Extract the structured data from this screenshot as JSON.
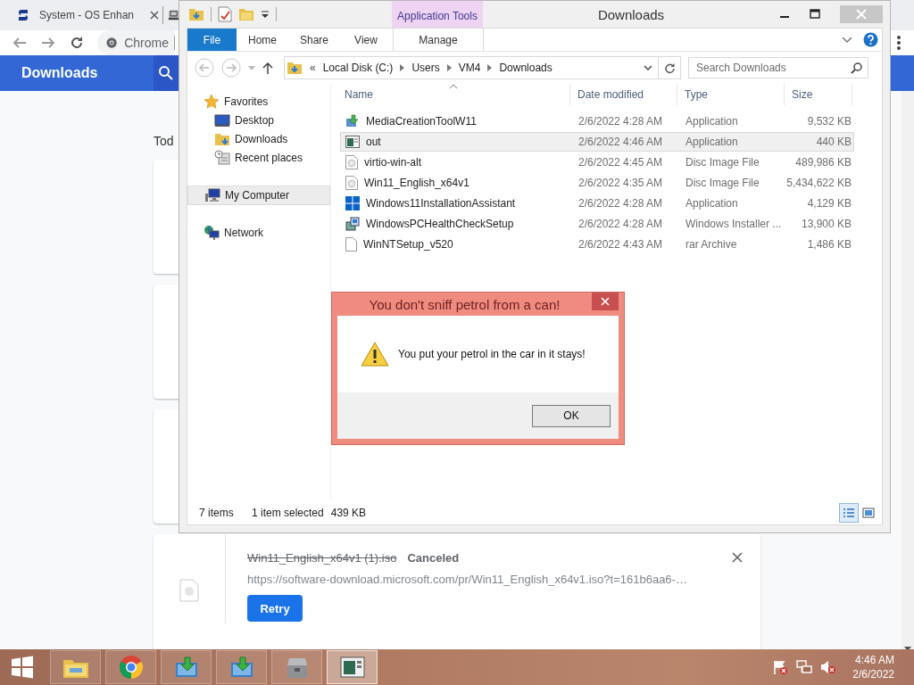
{
  "browser": {
    "tab": {
      "title": "System - OS Enhan"
    },
    "omnibox": {
      "text": "Chrome"
    },
    "header": {
      "title": "Downloads"
    },
    "section_heading": "Tod",
    "cards": [
      {
        "kind": "covered"
      },
      {
        "kind": "covered"
      },
      {
        "kind": "covered"
      },
      {
        "kind": "download",
        "file_name": "Win11_English_x64v1 (1).iso",
        "canceled": true,
        "status": "Canceled",
        "url": "https://software-download.microsoft.com/pr/Win11_English_x64v1.iso?t=161b6aa6-…",
        "action": "Retry"
      }
    ]
  },
  "explorer": {
    "title": "Downloads",
    "contextual_group": "Application Tools",
    "file_tab": "File",
    "tabs": [
      {
        "label": "Home",
        "contextual": false
      },
      {
        "label": "Share",
        "contextual": false
      },
      {
        "label": "View",
        "contextual": false
      },
      {
        "label": "Manage",
        "contextual": true
      }
    ],
    "breadcrumb": [
      "Local Disk (C:)",
      "Users",
      "VM4",
      "Downloads"
    ],
    "breadcrumb_overflow": "«",
    "search": {
      "placeholder": "Search Downloads"
    },
    "nav": [
      {
        "label": "Favorites",
        "kind": "favorites",
        "selected": false,
        "children": [
          {
            "label": "Desktop",
            "kind": "desktop",
            "selected": false
          },
          {
            "label": "Downloads",
            "kind": "downloads",
            "selected": false
          },
          {
            "label": "Recent places",
            "kind": "recent",
            "selected": false
          }
        ]
      },
      {
        "label": "My Computer",
        "kind": "computer",
        "selected": true
      },
      {
        "label": "Network",
        "kind": "network",
        "selected": false
      }
    ],
    "columns": [
      "Name",
      "Date modified",
      "Type",
      "Size"
    ],
    "files": [
      {
        "name": "MediaCreationToolW11",
        "date": "2/6/2022 4:28 AM",
        "type": "Application",
        "size": "9,532 KB",
        "kind": "setup",
        "selected": false
      },
      {
        "name": "out",
        "date": "2/6/2022 4:46 AM",
        "type": "Application",
        "size": "440 KB",
        "kind": "app",
        "selected": true
      },
      {
        "name": "virtio-win-alt",
        "date": "2/6/2022 4:45 AM",
        "type": "Disc Image File",
        "size": "489,986 KB",
        "kind": "disc",
        "selected": false
      },
      {
        "name": "Win11_English_x64v1",
        "date": "2/6/2022 4:35 AM",
        "type": "Disc Image File",
        "size": "5,434,622 KB",
        "kind": "disc",
        "selected": false
      },
      {
        "name": "Windows11InstallationAssistant",
        "date": "2/6/2022 4:28 AM",
        "type": "Application",
        "size": "4,129 KB",
        "kind": "windows",
        "selected": false
      },
      {
        "name": "WindowsPCHealthCheckSetup",
        "date": "2/6/2022 4:28 AM",
        "type": "Windows Installer ...",
        "size": "13,900 KB",
        "kind": "installer",
        "selected": false
      },
      {
        "name": "WinNTSetup_v520",
        "date": "2/6/2022 4:43 AM",
        "type": "rar Archive",
        "size": "1,486 KB",
        "kind": "blank",
        "selected": false
      }
    ],
    "status": {
      "count": "7 items",
      "selection": "1 item selected",
      "size": "439 KB"
    }
  },
  "dialog": {
    "title": "You don't sniff petrol from a can!",
    "message": "You put your petrol in the car in it stays!",
    "button": "OK"
  },
  "taskbar": {
    "apps": [
      {
        "kind": "explorer",
        "selected": false
      },
      {
        "kind": "chrome",
        "selected": false
      },
      {
        "kind": "installer",
        "selected": false
      },
      {
        "kind": "installer",
        "selected": false
      },
      {
        "kind": "toolbox",
        "selected": false
      },
      {
        "kind": "console",
        "selected": true
      }
    ],
    "tray": {
      "time": "4:46 AM",
      "date": "2/6/2022"
    }
  }
}
